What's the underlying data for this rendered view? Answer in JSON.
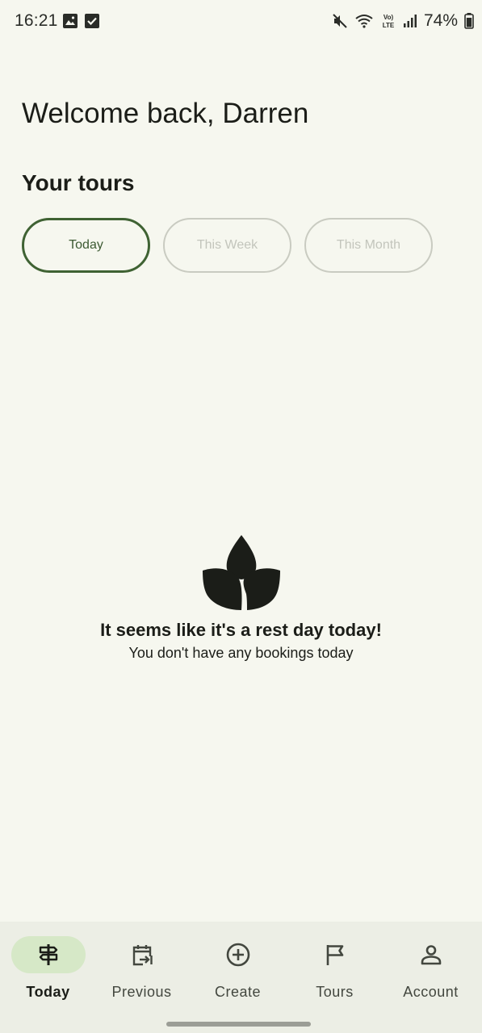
{
  "status_bar": {
    "time": "16:21",
    "battery": "74%",
    "left_icons": [
      "image-icon",
      "check-box-icon"
    ],
    "right_icons": [
      "mute-icon",
      "wifi-icon",
      "volte-icon",
      "signal-icon",
      "battery-icon"
    ]
  },
  "header": {
    "welcome": "Welcome back, Darren"
  },
  "tours": {
    "title": "Your tours",
    "filters": [
      "Today",
      "This Week",
      "This Month"
    ],
    "selected": "Today"
  },
  "empty_state": {
    "icon": "leaf-sprout-icon",
    "title": "It seems like it's a rest day today!",
    "subtitle": "You don't have any bookings today"
  },
  "bottom_nav": {
    "items": [
      {
        "label": "Today",
        "icon": "signpost-icon",
        "active": true
      },
      {
        "label": "Previous",
        "icon": "calendar-arrow-icon",
        "active": false
      },
      {
        "label": "Create",
        "icon": "add-circle-icon",
        "active": false
      },
      {
        "label": "Tours",
        "icon": "flag-icon",
        "active": false
      },
      {
        "label": "Account",
        "icon": "person-icon",
        "active": false
      }
    ]
  },
  "colors": {
    "background": "#f6f7ef",
    "accent": "#3f6233",
    "nav_background": "#eceee5",
    "nav_active_pill": "#d6e8c7",
    "chip_inactive_border": "#c9cbc1",
    "text_primary": "#1b1d18"
  }
}
